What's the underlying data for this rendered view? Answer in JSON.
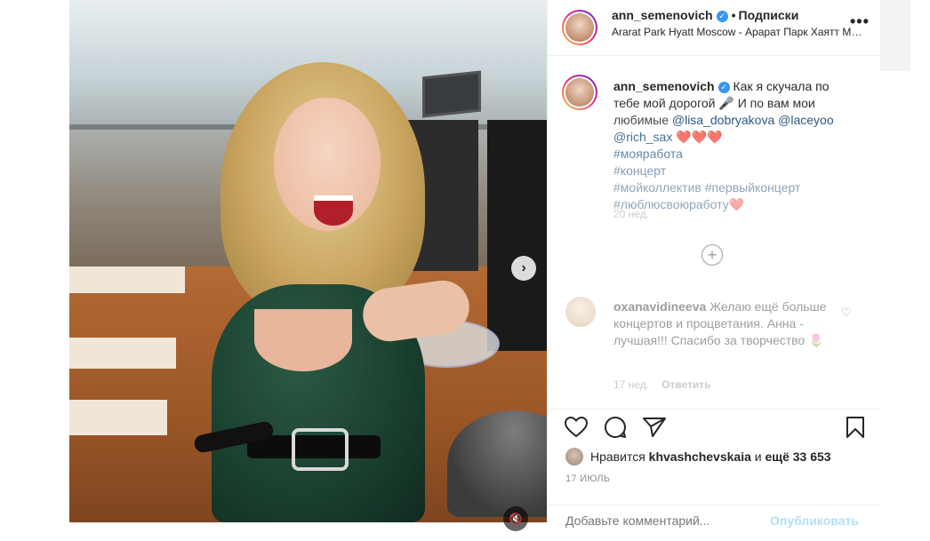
{
  "header": {
    "username": "ann_semenovich",
    "separator": "•",
    "follow_label": "Подписки",
    "location": "Ararat Park Hyatt Moscow - Арарат Парк Хаятт Москва",
    "more_label": "•••"
  },
  "caption": {
    "username": "ann_semenovich",
    "text_1": "Как я скучала по тебе мой дорогой",
    "mic_emoji": "🎤",
    "text_2": "И по вам мои любимые",
    "mention_1": "@lisa_dobryakova",
    "mention_2": "@laceyoo",
    "mention_3": "@rich_sax",
    "hearts": "❤️❤️❤️",
    "tag_1": "#моя работа",
    "tag_1_display": "#мояработа",
    "tag_2": "#концерт",
    "tag_3": "#мойколлектив",
    "tag_4": "#первыйконцерт",
    "tag_5": "#люблюсвоюработу",
    "tag_5_heart": "❤️",
    "time": "20 нед."
  },
  "load_more": "+",
  "comment": {
    "username": "oxanavidineeva",
    "text": "Желаю ещё больше концертов и процветания. Анна - лучшая!!! Спасибо за творчество",
    "emoji": "🌷",
    "time": "17 нед.",
    "reply_label": "Ответить",
    "like_icon": "♡"
  },
  "likes": {
    "prefix": "Нравится",
    "user": "khvashchevskaia",
    "suffix_1": "и",
    "suffix_2": "ещё 33 653"
  },
  "post_date": "17 ИЮЛЬ",
  "comment_box": {
    "placeholder": "Добавьте комментарий...",
    "post_label": "Опубликовать"
  },
  "media": {
    "next_icon": "›",
    "mute_icon": "🔇"
  }
}
